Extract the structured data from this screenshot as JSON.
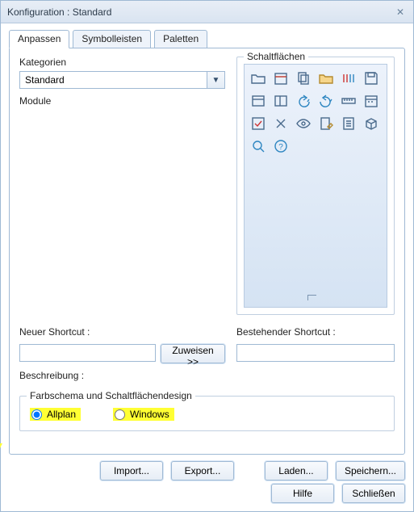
{
  "window": {
    "title": "Konfiguration :  Standard"
  },
  "tabs": [
    {
      "label": "Anpassen",
      "active": true
    },
    {
      "label": "Symbolleisten",
      "active": false
    },
    {
      "label": "Paletten",
      "active": false
    }
  ],
  "left": {
    "categories_label": "Kategorien",
    "category_value": "Standard",
    "module_label": "Module"
  },
  "right": {
    "buttons_legend": "Schaltflächen"
  },
  "icons": [
    "folder-icon",
    "calendar-icon",
    "copy-icon",
    "open-folder-icon",
    "bars-icon",
    "save-icon",
    "window-icon",
    "layout-icon",
    "undo-icon",
    "redo-icon",
    "ruler-icon",
    "date-icon",
    "checkbox-icon",
    "tools-icon",
    "eye-icon",
    "edit-page-icon",
    "page-icon",
    "box-icon",
    "search-zoom-icon",
    "help-icon"
  ],
  "shortcut": {
    "new_label": "Neuer Shortcut :",
    "existing_label": "Bestehender Shortcut :",
    "assign_btn": "Zuweisen >>",
    "description_label": "Beschreibung :"
  },
  "scheme": {
    "legend": "Farbschema und Schaltflächendesign",
    "opt_allplan": "Allplan",
    "opt_windows": "Windows"
  },
  "footer": {
    "import": "Import...",
    "export": "Export...",
    "load": "Laden...",
    "save": "Speichern...",
    "help": "Hilfe",
    "close": "Schließen"
  }
}
